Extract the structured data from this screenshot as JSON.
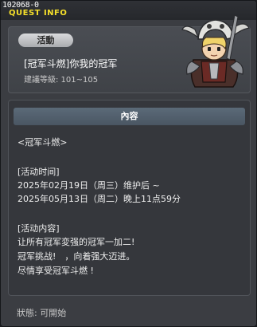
{
  "header": {
    "quest_id": "102068-0",
    "title": "QUEST INFO"
  },
  "summary": {
    "category": "活動",
    "quest_name": "[冠军斗燃]你我的冠军",
    "level_requirement": "建議等級: 101~105",
    "npc_icon": "armored-warrior-npc-icon"
  },
  "content": {
    "header": "內容",
    "lines": [
      "<冠军斗燃>",
      "",
      "[活动时间]",
      "2025年02月19日（周三）维护后 ~",
      "2025年05月13日（周二）晚上11点59分",
      "",
      "[活动内容]",
      "让所有冠军変强的冠军一加二!",
      "冠军挑战!　，向着强大迈进。",
      "尽情享受冠军斗燃 !"
    ]
  },
  "footer": {
    "status": "狀態: 可開始"
  },
  "colors": {
    "title_yellow": "#f6e02a",
    "content_header_blue": "#4f5c69",
    "panel_bg": "#3b3d42"
  }
}
